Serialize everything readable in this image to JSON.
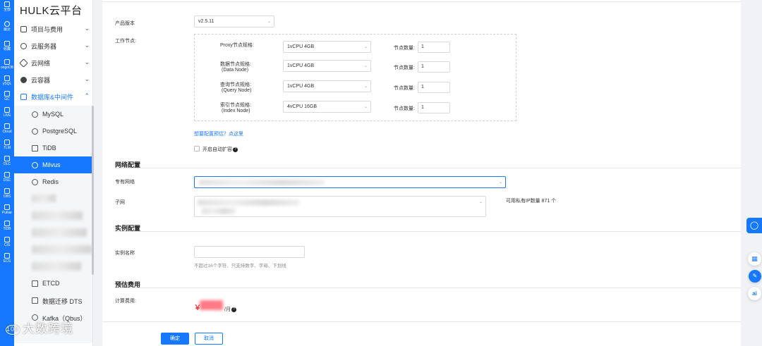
{
  "brand": "HULK云平台",
  "colors": {
    "primary": "#1677ff",
    "price_mask": "#ff7a86"
  },
  "rail": [
    "全部",
    "最近",
    "收藏",
    "ongoDB",
    "ySQL",
    "GC",
    "LIVE",
    "Cloud",
    "TLM",
    "DLC",
    "DSC",
    "OBS",
    "Pulsar",
    "TiDB",
    "CIS",
    "ECS"
  ],
  "nav": {
    "groups": [
      {
        "label": "项目与费用",
        "icon": "project-icon"
      },
      {
        "label": "云服务器",
        "icon": "cloud-server-icon"
      },
      {
        "label": "云网络",
        "icon": "network-icon"
      },
      {
        "label": "云容器",
        "icon": "container-icon"
      },
      {
        "label": "数据库&中间件",
        "icon": "database-icon"
      }
    ],
    "items": [
      {
        "label": "MySQL",
        "icon": "mysql-icon"
      },
      {
        "label": "PostgreSQL",
        "icon": "postgresql-icon"
      },
      {
        "label": "TiDB",
        "icon": "tidb-icon"
      },
      {
        "label": "Milvus",
        "icon": "milvus-icon"
      },
      {
        "label": "Redis",
        "icon": "redis-icon"
      },
      {
        "label": "ETCD",
        "icon": "etcd-icon"
      },
      {
        "label": "数据迁移 DTS",
        "icon": "dts-icon"
      },
      {
        "label": "Kafka（Qbus）",
        "icon": "kafka-icon"
      }
    ]
  },
  "form": {
    "version_label": "产品版本",
    "version_value": "v2.5.11",
    "worker_label": "工作节点:",
    "nodes": [
      {
        "spec_label": "Proxy节点规格:",
        "spec_sub": "",
        "spec_value": "1vCPU 4GB",
        "count_label": "节点数量:",
        "count": "1"
      },
      {
        "spec_label": "数据节点规格:",
        "spec_sub": "(Data Node)",
        "spec_value": "1vCPU 4GB",
        "count_label": "节点数量:",
        "count": "1"
      },
      {
        "spec_label": "查询节点规格:",
        "spec_sub": "(Query Node)",
        "spec_value": "1vCPU 4GB",
        "count_label": "节点数量:",
        "count": "1"
      },
      {
        "spec_label": "索引节点规格:",
        "spec_sub": "(Index Node)",
        "spec_value": "4vCPU 16GB",
        "count_label": "节点数量:",
        "count": "1"
      }
    ],
    "config_link": "想要配置预估？点这里",
    "autoscale_label": "开启自动扩容",
    "network_section": "网络配置",
    "vpc_label": "专有网络",
    "subnet_label": "子网",
    "ip_count_text": "可用私有IP数量 871 个",
    "instance_section": "实例配置",
    "instance_name_label": "实例名称",
    "instance_name_placeholder": "",
    "instance_name_hint": "不超过16个字符、只支持数字、字母、下划线",
    "price_section": "预估费用",
    "fee_label": "计算费用:",
    "currency": "￥",
    "per_month": "/月",
    "confirm": "确定",
    "cancel": "取消"
  },
  "watermark": {
    "badge": "100",
    "text": "大数跨境"
  }
}
